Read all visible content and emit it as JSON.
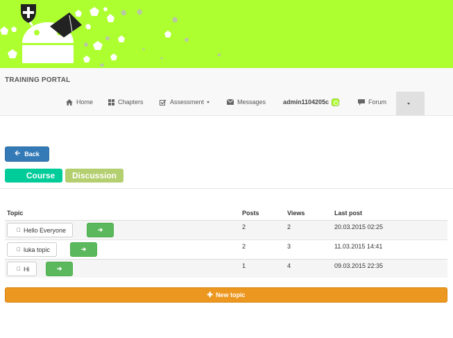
{
  "brand": "TRAINING PORTAL",
  "nav": {
    "home": "Home",
    "chapters": "Chapters",
    "assessment": "Assessment",
    "messages": "Messages",
    "user": "admin1104205c",
    "forum": "Forum"
  },
  "buttons": {
    "back": "Back",
    "new_topic": "New topic"
  },
  "tabs": {
    "course": "Course",
    "discussion": "Discussion"
  },
  "table": {
    "headers": {
      "topic": "Topic",
      "posts": "Posts",
      "views": "Views",
      "last_post": "Last post"
    },
    "rows": [
      {
        "topic": "Hello Everyone",
        "posts": "2",
        "views": "2",
        "last_post": "20.03.2015 02:25"
      },
      {
        "topic": "luka topic",
        "posts": "2",
        "views": "3",
        "last_post": "11.03.2015 14:41"
      },
      {
        "topic": "Hi",
        "posts": "1",
        "views": "4",
        "last_post": "09.03.2015 22:35"
      }
    ]
  },
  "colors": {
    "banner": "#adff2f",
    "primary": "#337ab7",
    "course_tab": "#00cc99",
    "discussion_tab": "#b4cf6f",
    "success": "#5cb85c",
    "warning": "#ec971f"
  }
}
